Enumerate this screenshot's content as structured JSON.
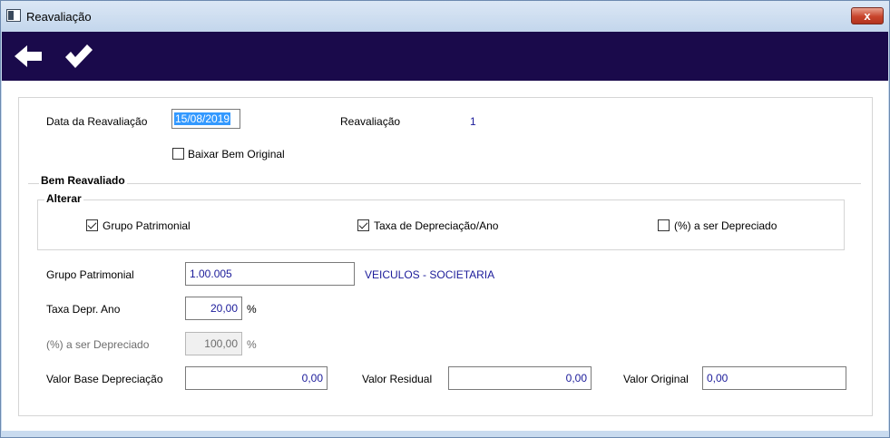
{
  "window": {
    "title": "Reavaliação",
    "close_label": "x"
  },
  "toolbar": {
    "back_icon": "arrow-left-icon",
    "confirm_icon": "checkmark-icon"
  },
  "form": {
    "data_label": "Data da Reavaliação",
    "data_value": "15/08/2019",
    "reavaliacao_label": "Reavaliação",
    "reavaliacao_value": "1",
    "baixar_label": "Baixar Bem Original",
    "baixar_checked": false
  },
  "bem": {
    "title": "Bem Reavaliado",
    "alterar": {
      "title": "Alterar",
      "grupo_label": "Grupo Patrimonial",
      "grupo_checked": true,
      "taxa_label": "Taxa de Depreciação/Ano",
      "taxa_checked": true,
      "percent_label": "(%) a ser Depreciado",
      "percent_checked": false
    },
    "grupo_label": "Grupo Patrimonial",
    "grupo_value": "1.00.005",
    "grupo_desc": "VEICULOS - SOCIETARIA",
    "taxa_label": "Taxa Depr. Ano",
    "taxa_value": "20,00",
    "taxa_unit": "%",
    "percent_label": "(%) a ser Depreciado",
    "percent_value": "100,00",
    "percent_unit": "%",
    "base_label": "Valor Base Depreciação",
    "base_value": "0,00",
    "residual_label": "Valor Residual",
    "residual_value": "0,00",
    "original_label": "Valor Original",
    "original_value": "0,00"
  }
}
